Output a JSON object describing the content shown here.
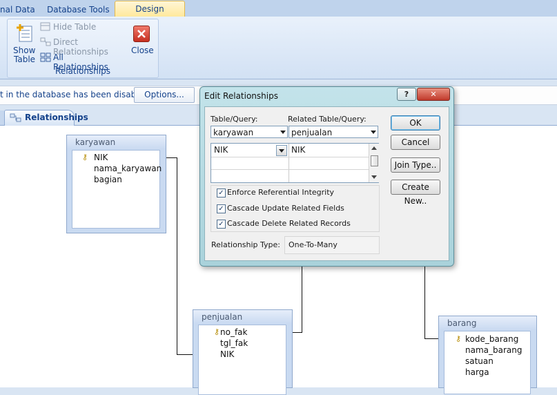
{
  "tabs": [
    "nal Data",
    "Database Tools",
    "Design"
  ],
  "ribbon": {
    "show_table_line1": "Show",
    "show_table_line2": "Table",
    "hide_table": "Hide Table",
    "direct_relationships": "Direct Relationships",
    "all_relationships": "All Relationships",
    "close": "Close",
    "group_label": "Relationships"
  },
  "message_bar": {
    "text": "t in the database has been disabled",
    "options": "Options..."
  },
  "document_tab": "Relationships",
  "tables": {
    "karyawan": {
      "title": "karyawan",
      "fields": [
        "NIK",
        "nama_karyawan",
        "bagian"
      ]
    },
    "penjualan": {
      "title": "penjualan",
      "fields": [
        "no_fak",
        "tgl_fak",
        "NIK"
      ]
    },
    "barang": {
      "title": "barang",
      "fields": [
        "kode_barang",
        "nama_barang",
        "satuan",
        "harga"
      ]
    }
  },
  "dialog": {
    "title": "Edit Relationships",
    "help": "?",
    "close": "✕",
    "table_query_label": "Table/Query:",
    "related_label": "Related Table/Query:",
    "table_value": "karyawan",
    "related_value": "penjualan",
    "field_left": "NIK",
    "field_right": "NIK",
    "enforce": "Enforce Referential Integrity",
    "cascade_update": "Cascade Update Related Fields",
    "cascade_delete": "Cascade Delete Related Records",
    "relationship_type_label": "Relationship Type:",
    "relationship_type_value": "One-To-Many",
    "ok": "OK",
    "cancel": "Cancel",
    "join_type": "Join Type..",
    "create_new": "Create New.."
  },
  "colors": {
    "ribbon_text": "#15428b",
    "dialog_frame": "#a9d2db",
    "key_icon": "#b58a00"
  }
}
